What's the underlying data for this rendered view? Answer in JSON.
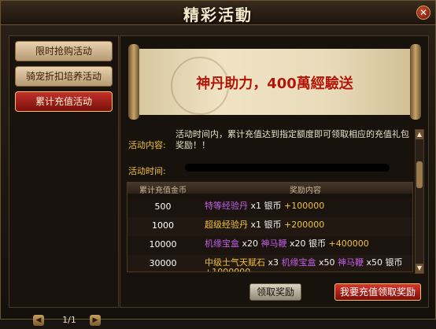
{
  "window": {
    "title": "精彩活動"
  },
  "sidebar": {
    "tabs": [
      {
        "label": "限时抢购活动",
        "state": "normal"
      },
      {
        "label": "骑宠折扣培养活动",
        "state": "normal"
      },
      {
        "label": "累计充值活动",
        "state": "active"
      }
    ],
    "pager": {
      "text": "1/1"
    }
  },
  "banner": {
    "text": "神丹助力，400萬經驗送"
  },
  "activity": {
    "content_label": "活动内容:",
    "content_text": "活动时间内，累计充值达到指定额度即可领取相应的充值礼包奖励！！",
    "time_label": "活动时间:",
    "time_value": "██████████████████████████"
  },
  "table": {
    "headers": [
      "累计充值金币",
      "奖励内容"
    ],
    "rows": [
      {
        "amount": "500",
        "reward": [
          {
            "text": "特等经验丹",
            "color": "purple"
          },
          {
            "text": " x1 银币 ",
            "color": "white"
          },
          {
            "text": "+100000",
            "color": "yellow"
          }
        ]
      },
      {
        "amount": "1000",
        "reward": [
          {
            "text": "超级经验丹",
            "color": "yellow"
          },
          {
            "text": " x1 银币 ",
            "color": "white"
          },
          {
            "text": "+200000",
            "color": "yellow"
          }
        ]
      },
      {
        "amount": "10000",
        "reward": [
          {
            "text": "机缘宝盒",
            "color": "purple"
          },
          {
            "text": " x20 ",
            "color": "white"
          },
          {
            "text": "神马鞭",
            "color": "purple"
          },
          {
            "text": " x20 银币 ",
            "color": "white"
          },
          {
            "text": "+400000",
            "color": "yellow"
          }
        ]
      },
      {
        "amount": "30000",
        "reward": [
          {
            "text": "中级士气天赋石",
            "color": "yellow"
          },
          {
            "text": " x3 ",
            "color": "white"
          },
          {
            "text": "机缘宝盒",
            "color": "purple"
          },
          {
            "text": " x50 ",
            "color": "white"
          },
          {
            "text": "神马鞭",
            "color": "purple"
          },
          {
            "text": " x50 银币 ",
            "color": "white"
          },
          {
            "text": "+1000000",
            "color": "yellow"
          }
        ]
      }
    ]
  },
  "buttons": {
    "claim": "领取奖励",
    "recharge": "我要充值领取奖励"
  },
  "colors": {
    "accent_gold": "#f2c23c",
    "reward_purple": "#c05ee8",
    "active_tab_red": "#c1322a"
  }
}
